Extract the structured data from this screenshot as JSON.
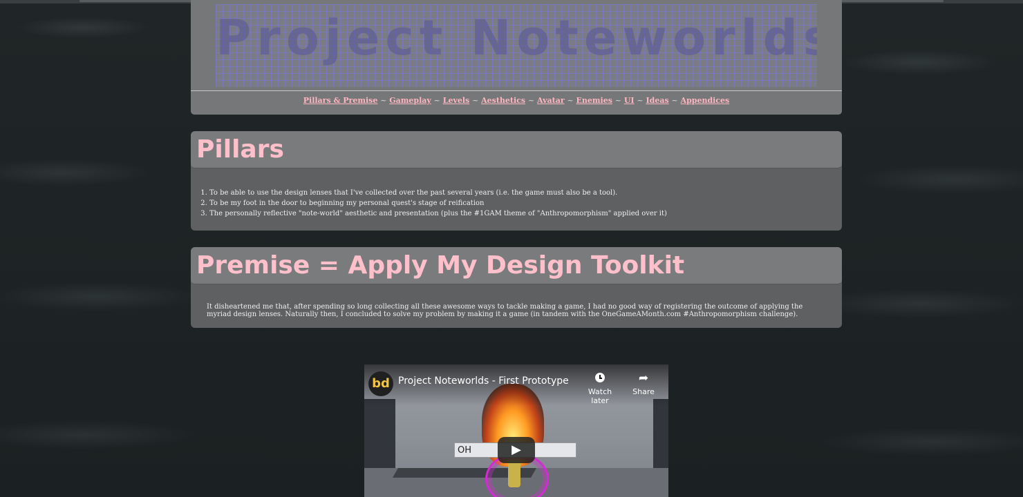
{
  "header": {
    "banner_text": "Project Noteworlds",
    "nav": [
      {
        "label": "Pillars & Premise"
      },
      {
        "label": "Gameplay"
      },
      {
        "label": "Levels"
      },
      {
        "label": "Aesthetics"
      },
      {
        "label": "Avatar"
      },
      {
        "label": "Enemies"
      },
      {
        "label": "UI"
      },
      {
        "label": "Ideas"
      },
      {
        "label": "Appendices"
      }
    ],
    "nav_separator": "~"
  },
  "pillars": {
    "title": "Pillars",
    "items": [
      "To be able to use the design lenses that I've collected over the past several years (i.e. the game must also be a tool).",
      "To be my foot in the door to beginning my personal quest's stage of reification",
      "The personally reflective \"note-world\" aesthetic and presentation (plus the #1GAM theme of \"Anthropomorphism\" applied over it)"
    ]
  },
  "premise": {
    "title": "Premise = Apply My Design Toolkit",
    "body": "It disheartened me that, after spending so long collecting all these awesome ways to tackle making a game, I had no good way of registering the outcome of applying the myriad design lenses. Naturally then, I concluded to solve my problem by making it a game (in tandem with the OneGameAMonth.com #Anthropomorphism challenge)."
  },
  "video": {
    "channel_logo": "bd",
    "title": "Project Noteworlds - First Prototype",
    "watch_later": "Watch later",
    "share": "Share",
    "in_game_text": "OH"
  },
  "colors": {
    "heading": "#ffc0cb",
    "nav_link": "#ffb6c1",
    "panel": "#767778",
    "section_body": "#5f6061"
  }
}
